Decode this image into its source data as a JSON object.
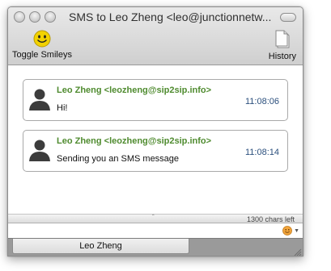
{
  "window": {
    "title": "SMS to Leo Zheng <leo@junctionnetw..."
  },
  "toolbar": {
    "toggle_smileys_label": "Toggle Smileys",
    "history_label": "History"
  },
  "messages": [
    {
      "sender": "Leo Zheng  <leozheng@sip2sip.info>",
      "time": "11:08:06",
      "text": "Hi!"
    },
    {
      "sender": "Leo Zheng  <leozheng@sip2sip.info>",
      "time": "11:08:14",
      "text": "Sending you an SMS message"
    }
  ],
  "composer": {
    "chars_left": "1300 chars left",
    "value": ""
  },
  "tabs": [
    {
      "label": "Leo Zheng"
    }
  ],
  "colors": {
    "sender": "#4f8b2f",
    "time": "#2b4f7d",
    "smiley": "#f2d200"
  },
  "icons": [
    "smiley-icon",
    "history-document-icon",
    "user-avatar-icon",
    "emoji-picker-icon",
    "resize-grip-icon"
  ]
}
